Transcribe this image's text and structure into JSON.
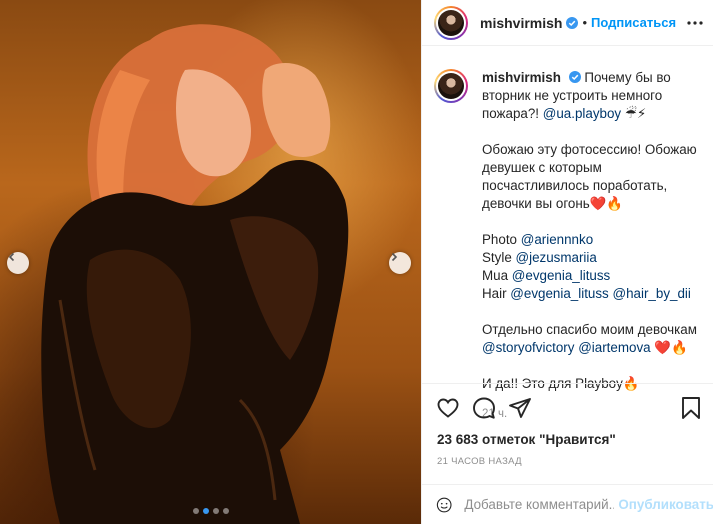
{
  "post": {
    "username": "mishvirmish",
    "follow_label": "Подписаться",
    "separator": "•",
    "caption_lines": [
      "Почему бы во вторник не устроить немного пожара?!",
      "@ua.playboy",
      "☔⚡"
    ],
    "caption": {
      "p1_text": "Почему бы во вторник не устроить немного пожара?!",
      "p1_mention": "@ua.playboy",
      "p1_emoji": "☔⚡",
      "p2": "Обожаю эту фотосессию! Обожаю девушек с которым посчастливилось поработать, девочки вы огонь",
      "p2_emoji": "❤️🔥",
      "credits": [
        {
          "role": "Photo",
          "handles": [
            "@ariennnko"
          ]
        },
        {
          "role": "Style",
          "handles": [
            "@jezusmariia"
          ]
        },
        {
          "role": "Mua",
          "handles": [
            "@evgenia_lituss"
          ]
        },
        {
          "role": "Hair",
          "handles": [
            "@evgenia_lituss",
            "@hair_by_dii"
          ]
        }
      ],
      "p4_text": "Отдельно спасибо моим девочкам",
      "p4_mentions": [
        "@storyofvictory",
        "@iartemova"
      ],
      "p4_emoji": "❤️🔥",
      "p5_text": "И да!! Это для Playboy",
      "p5_emoji": "🔥"
    },
    "caption_time": "21 ч.",
    "likes_text": "23 683 отметок \"Нравится\"",
    "posted_ago": "21 ЧАСОВ НАЗАД",
    "comment_placeholder": "Добавьте комментарий...",
    "publish_label": "Опубликовать",
    "carousel": {
      "total": 4,
      "active": 2
    }
  },
  "colors": {
    "accent": "#0095f6",
    "verified": "#3897f0",
    "mention": "#00376b",
    "muted": "#8e8e8e",
    "publish_disabled": "#b2dffc"
  },
  "icons": [
    "chevron-left-icon",
    "chevron-right-icon",
    "verified-badge-icon",
    "more-options-icon",
    "heart-icon",
    "comment-icon",
    "share-icon",
    "bookmark-icon",
    "emoji-icon"
  ]
}
